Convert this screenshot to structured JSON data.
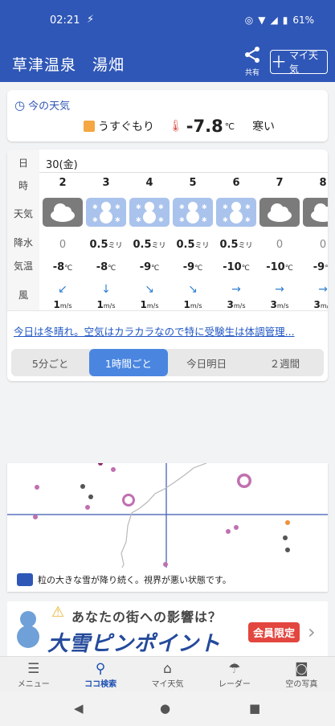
{
  "status": {
    "time": "02:21",
    "battery": "61%"
  },
  "header": {
    "title": "草津温泉　湯畑",
    "share_label": "共有",
    "my_weather_label": "マイ天気"
  },
  "now": {
    "title": "今の天気",
    "condition": "うすぐもり",
    "temperature": "-7.8",
    "temp_unit": "℃",
    "feel": "寒い"
  },
  "forecast": {
    "row_labels": [
      "日",
      "時",
      "天気",
      "降水",
      "気温",
      "風"
    ],
    "day": "30(金)",
    "hours": [
      {
        "hour": "2",
        "icon": "cloud",
        "precip": "0",
        "precip_unit": "",
        "temp": "-8",
        "wind_dir": "↙",
        "wind": "1"
      },
      {
        "hour": "3",
        "icon": "snow",
        "precip": "0.5",
        "precip_unit": "ミリ",
        "temp": "-8",
        "wind_dir": "↓",
        "wind": "1"
      },
      {
        "hour": "4",
        "icon": "snow",
        "precip": "0.5",
        "precip_unit": "ミリ",
        "temp": "-9",
        "wind_dir": "↘",
        "wind": "1"
      },
      {
        "hour": "5",
        "icon": "snow",
        "precip": "0.5",
        "precip_unit": "ミリ",
        "temp": "-9",
        "wind_dir": "↘",
        "wind": "1"
      },
      {
        "hour": "6",
        "icon": "snow",
        "precip": "0.5",
        "precip_unit": "ミリ",
        "temp": "-10",
        "wind_dir": "→",
        "wind": "3"
      },
      {
        "hour": "7",
        "icon": "cloud",
        "precip": "0",
        "precip_unit": "",
        "temp": "-10",
        "wind_dir": "→",
        "wind": "3"
      },
      {
        "hour": "8",
        "icon": "cloud",
        "precip": "0",
        "precip_unit": "",
        "temp": "-9",
        "wind_dir": "→",
        "wind": "3"
      }
    ],
    "temp_unit": "℃",
    "wind_unit": "m/s",
    "comment": "今日は冬晴れ。空気はカラカラなので特に受験生は体調管理...",
    "tabs": [
      "5分ごと",
      "1時間ごと",
      "今日明日",
      "２週間"
    ],
    "active_tab": "1時間ごと"
  },
  "radar_caption": "粒の大きな雪が降り続く。視界が悪い状態です。",
  "banner": {
    "line1": "あなたの街への影響は？",
    "line2": "大雪ピンポイント",
    "tag": "会員限定"
  },
  "nav": [
    "メニュー",
    "ココ検索",
    "マイ天気",
    "レーダー",
    "空の写真"
  ],
  "nav_active": "ココ検索",
  "colors": {
    "brand": "#2f57b7",
    "accent": "#4a86e0",
    "link": "#1f56c4",
    "badge": "#e2463f"
  }
}
